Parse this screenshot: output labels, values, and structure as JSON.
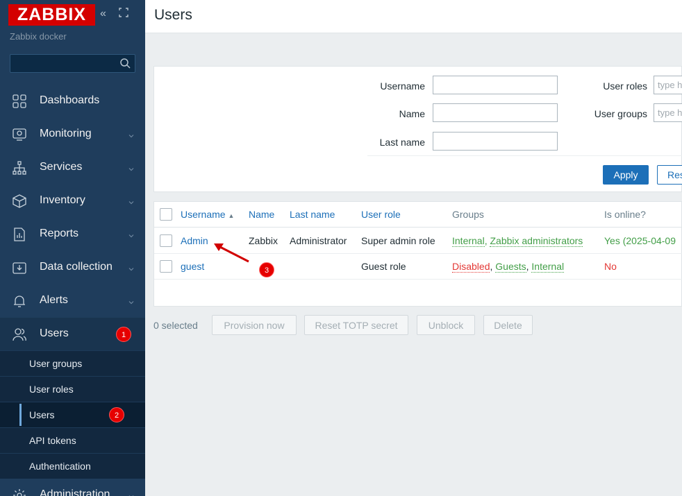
{
  "sidebar": {
    "logo": "ZABBIX",
    "server_name": "Zabbix docker",
    "search_placeholder": "",
    "items": [
      {
        "label": "Dashboards",
        "icon": "dashboards-icon"
      },
      {
        "label": "Monitoring",
        "icon": "monitoring-icon"
      },
      {
        "label": "Services",
        "icon": "services-icon"
      },
      {
        "label": "Inventory",
        "icon": "inventory-icon"
      },
      {
        "label": "Reports",
        "icon": "reports-icon"
      },
      {
        "label": "Data collection",
        "icon": "data-collection-icon"
      },
      {
        "label": "Alerts",
        "icon": "alerts-icon"
      },
      {
        "label": "Users",
        "icon": "users-icon",
        "badge": "1"
      },
      {
        "label": "Administration",
        "icon": "administration-icon"
      }
    ],
    "subitems": [
      {
        "label": "User groups"
      },
      {
        "label": "User roles"
      },
      {
        "label": "Users",
        "badge": "2"
      },
      {
        "label": "API tokens"
      },
      {
        "label": "Authentication"
      }
    ]
  },
  "header": {
    "title": "Users"
  },
  "filter": {
    "username_label": "Username",
    "name_label": "Name",
    "lastname_label": "Last name",
    "user_roles_label": "User roles",
    "user_groups_label": "User groups",
    "user_roles_placeholder": "type here to search",
    "user_groups_placeholder": "type here to search",
    "apply_label": "Apply",
    "reset_label": "Reset"
  },
  "table": {
    "columns": [
      "Username",
      "Name",
      "Last name",
      "User role",
      "Groups",
      "Is online?"
    ],
    "sort_indicator": "▲",
    "rows": [
      {
        "username": "Admin",
        "name": "Zabbix",
        "last_name": "Administrator",
        "user_role": "Super admin role",
        "groups": [
          "Internal",
          "Zabbix administrators"
        ],
        "online": "Yes (2025-04-09"
      },
      {
        "username": "guest",
        "name": "",
        "last_name": "",
        "user_role": "Guest role",
        "groups": [
          "Disabled",
          "Guests",
          "Internal"
        ],
        "online": "No"
      }
    ]
  },
  "bulk": {
    "selected": "0 selected",
    "buttons": [
      "Provision now",
      "Reset TOTP secret",
      "Unblock",
      "Delete"
    ]
  },
  "annotation": {
    "badge": "3"
  },
  "colors": {
    "sidebar": "#1f3d5c",
    "brand_red": "#d40000",
    "link": "#1c6fb8",
    "green": "#429e47",
    "red": "#e33734"
  }
}
